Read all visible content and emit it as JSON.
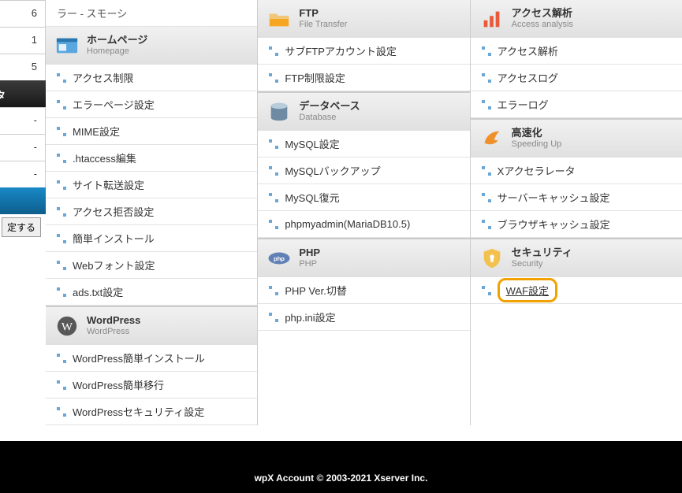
{
  "side": {
    "counts": [
      "6",
      "1",
      "5"
    ],
    "dashes": [
      "-",
      "-",
      "-"
    ],
    "button_label": "定する"
  },
  "col1": {
    "top_item": "ラー - スモーシ",
    "homepage": {
      "title": "ホームページ",
      "sub": "Homepage",
      "items": [
        "アクセス制限",
        "エラーページ設定",
        "MIME設定",
        ".htaccess編集",
        "サイト転送設定",
        "アクセス拒否設定",
        "簡単インストール",
        "Webフォント設定",
        "ads.txt設定"
      ]
    },
    "wordpress": {
      "title": "WordPress",
      "sub": "WordPress",
      "items": [
        "WordPress簡単インストール",
        "WordPress簡単移行",
        "WordPressセキュリティ設定"
      ]
    }
  },
  "col2": {
    "ftp": {
      "title": "FTP",
      "sub": "File Transfer",
      "items": [
        "サブFTPアカウント設定",
        "FTP制限設定"
      ]
    },
    "database": {
      "title": "データベース",
      "sub": "Database",
      "items": [
        "MySQL設定",
        "MySQLバックアップ",
        "MySQL復元",
        "phpmyadmin(MariaDB10.5)"
      ]
    },
    "php": {
      "title": "PHP",
      "sub": "PHP",
      "items": [
        "PHP Ver.切替",
        "php.ini設定"
      ]
    }
  },
  "col3": {
    "access": {
      "title": "アクセス解析",
      "sub": "Access analysis",
      "items": [
        "アクセス解析",
        "アクセスログ",
        "エラーログ"
      ]
    },
    "speed": {
      "title": "高速化",
      "sub": "Speeding Up",
      "items": [
        "Xアクセラレータ",
        "サーバーキャッシュ設定",
        "ブラウザキャッシュ設定"
      ]
    },
    "security": {
      "title": "セキュリティ",
      "sub": "Security",
      "items": [
        "WAF設定"
      ]
    }
  },
  "footer": "wpX Account © 2003-2021 Xserver Inc."
}
